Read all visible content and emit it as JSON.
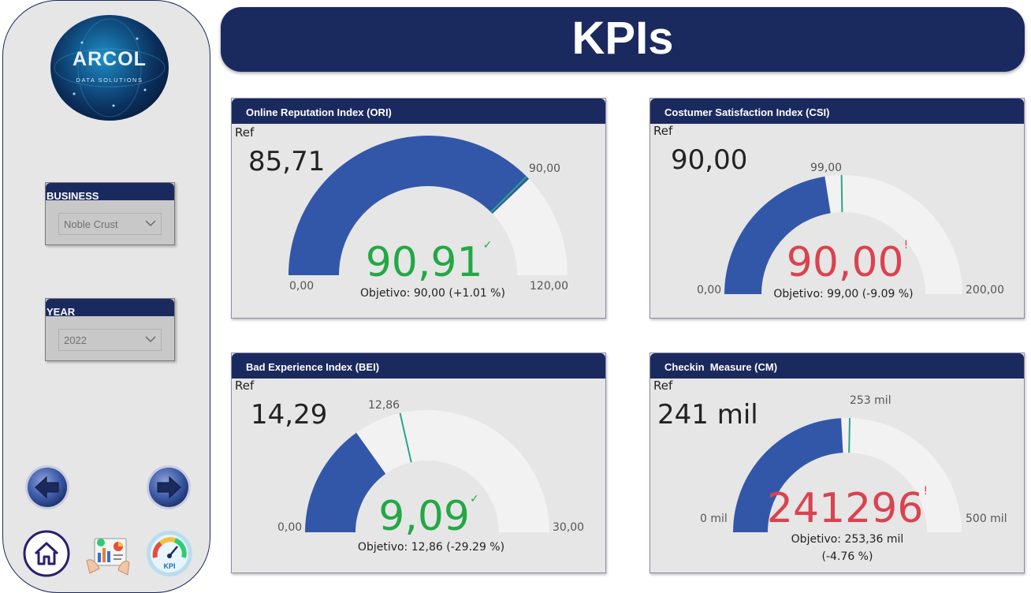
{
  "logo": {
    "word": "ARCOL",
    "subtitle": "DATA SOLUTIONS"
  },
  "filters": {
    "business": {
      "label": "BUSINESS",
      "value": "Noble Crust"
    },
    "year": {
      "label": "YEAR",
      "value": "2022"
    }
  },
  "title": "KPIs",
  "colors": {
    "navy": "#1b2a5e",
    "gauge_fill": "#3357a8",
    "gauge_track": "#f2f2f2",
    "target": "#2aa68a",
    "good": "#22a845",
    "bad": "#d9434f"
  },
  "cards": {
    "ori": {
      "title": "Online Reputation Index (ORI)",
      "ref_label": "Ref",
      "ref_value": "85,71",
      "value_text": "90,91",
      "mark": "✓",
      "min_label": "0,00",
      "max_label": "120,00",
      "target_label": "90,00",
      "goal_text": "Objetivo: 90,00 (+1.01 %)",
      "gauge": {
        "min": 0,
        "max": 120,
        "value": 90.91,
        "target": 90
      }
    },
    "csi": {
      "title": "Costumer Satisfaction Index (CSI)",
      "ref_label": "Ref",
      "ref_value": "90,00",
      "value_text": "90,00",
      "mark": "!",
      "min_label": "0,00",
      "max_label": "200,00",
      "target_label": "99,00",
      "goal_text": "Objetivo: 99,00 (-9.09 %)",
      "gauge": {
        "min": 0,
        "max": 200,
        "value": 90,
        "target": 99
      }
    },
    "bei": {
      "title": "Bad Experience Index (BEI)",
      "ref_label": "Ref",
      "ref_value": "14,29",
      "value_text": "9,09",
      "mark": "✓",
      "min_label": "0,00",
      "max_label": "30,00",
      "target_label": "12,86",
      "goal_text": "Objetivo: 12,86 (-29.29 %)",
      "gauge": {
        "min": 0,
        "max": 30,
        "value": 9.09,
        "target": 12.86
      }
    },
    "cm": {
      "title": "Checkin  Measure (CM)",
      "ref_label": "Ref",
      "ref_value": "241 mil",
      "value_text": "241296",
      "mark": "!",
      "min_label": "0 mil",
      "max_label": "500 mil",
      "target_label": "253 mil",
      "goal_line1": "Objetivo: 253,36 mil",
      "goal_line2": "(-4.76 %)",
      "gauge": {
        "min": 0,
        "max": 500,
        "value": 241296,
        "target": 253360,
        "scale": 1000
      }
    }
  }
}
